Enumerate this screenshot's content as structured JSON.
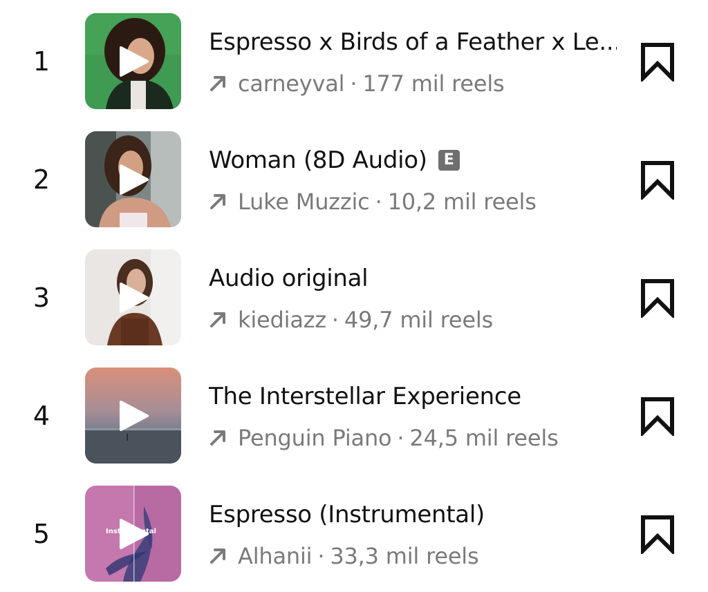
{
  "tracks": [
    {
      "rank": "1",
      "title": "Espresso x Birds of a Feather x Le...",
      "explicit": "",
      "artist": "carneyval",
      "separator": "·",
      "reels": "177 mil reels",
      "thumb_icon": "play-icon"
    },
    {
      "rank": "2",
      "title": "Woman (8D Audio)",
      "explicit": "E",
      "artist": "Luke Muzzic",
      "separator": "·",
      "reels": "10,2 mil reels",
      "thumb_icon": "play-icon"
    },
    {
      "rank": "3",
      "title": "Audio original",
      "explicit": "",
      "artist": "kiediazz",
      "separator": "·",
      "reels": "49,7 mil reels",
      "thumb_icon": "play-icon"
    },
    {
      "rank": "4",
      "title": "The Interstellar Experience",
      "explicit": "",
      "artist": "Penguin Piano",
      "separator": "·",
      "reels": "24,5 mil reels",
      "thumb_icon": "play-icon"
    },
    {
      "rank": "5",
      "title": "Espresso (Instrumental)",
      "explicit": "",
      "artist": "Alhanii",
      "separator": "·",
      "reels": "33,3 mil reels",
      "thumb_icon": "play-icon",
      "cover_text": "Instrumental"
    }
  ],
  "icons": {
    "trend": "trending-up-arrow-icon",
    "save": "bookmark-icon"
  },
  "colors": {
    "text_primary": "#111111",
    "text_secondary": "#7a7a7a",
    "explicit_badge": "#6f6f6f",
    "thumb1_bg": "#3f9a52",
    "thumb5_bg": "#c478ad"
  }
}
